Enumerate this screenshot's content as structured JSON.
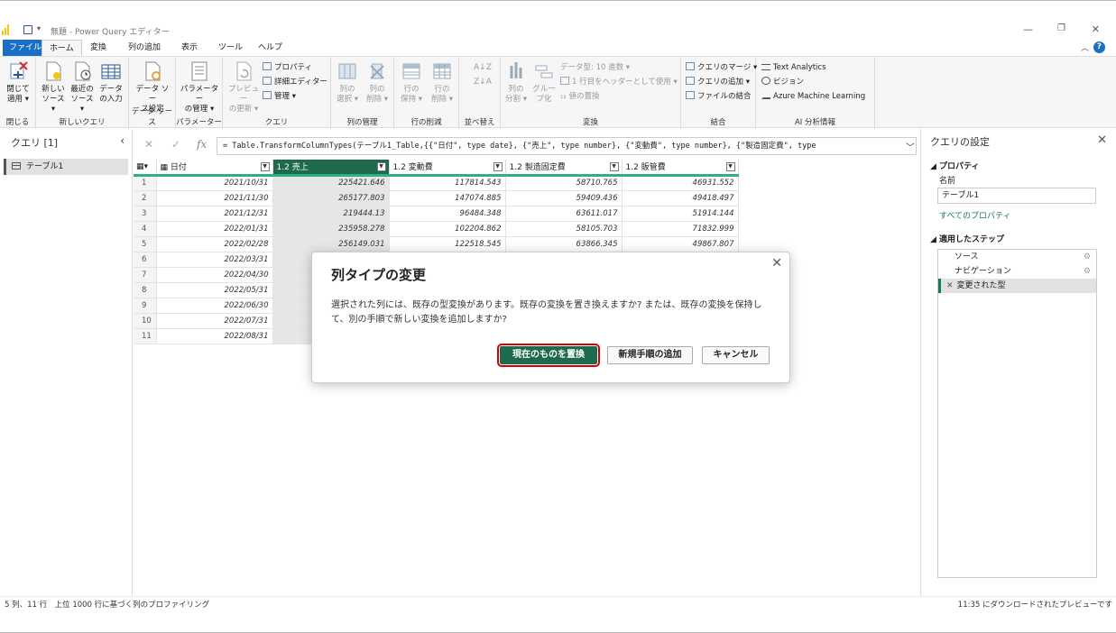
{
  "window": {
    "title": "無題 - Power Query エディター",
    "controls": {
      "minimize": "—",
      "restore": "❐",
      "close": "✕"
    }
  },
  "menu": {
    "tabs": [
      {
        "label": "ファイル"
      },
      {
        "label": "ホーム"
      },
      {
        "label": "変換"
      },
      {
        "label": "列の追加"
      },
      {
        "label": "表示"
      },
      {
        "label": "ツール"
      },
      {
        "label": "ヘルプ"
      }
    ],
    "help": "?"
  },
  "ribbon": {
    "close_apply": "閉じて\n適用 ▾",
    "new_source": "新しい\nソース ▾",
    "recent_sources": "最近の\nソース ▾",
    "enter_data": "データ\nの入力",
    "datasource_settings": "データ ソー\nス設定",
    "manage_params": "パラメーター\nの管理 ▾",
    "refresh_preview": "プレビュー\nの更新 ▾",
    "properties": "プロパティ",
    "advanced_editor": "詳細エディター",
    "manage": "管理 ▾",
    "choose_columns": "列の\n選択 ▾",
    "remove_columns": "列の\n削除 ▾",
    "keep_rows": "行の\n保持 ▾",
    "remove_rows": "行の\n削除 ▾",
    "split_column": "列の\n分割 ▾",
    "group_by": "グルー\nプ化",
    "data_type": "データ型: 10 進数 ▾",
    "use_first_row": "1 行目をヘッダーとして使用 ▾",
    "replace_values": "₁₂ 値の置換",
    "merge_queries": "クエリのマージ ▾",
    "append_queries": "クエリの追加 ▾",
    "combine_files": "ファイルの結合",
    "text_analytics": "Text Analytics",
    "vision": "ビジョン",
    "azure_ml": "Azure Machine Learning",
    "groups": [
      "閉じる",
      "新しいクエリ",
      "データ ソース",
      "パラメーター",
      "クエリ",
      "列の管理",
      "行の削減",
      "並べ替え",
      "変換",
      "結合",
      "AI 分析情報"
    ]
  },
  "queries_pane": {
    "header": "クエリ [1]",
    "items": [
      {
        "label": "テーブル1"
      }
    ]
  },
  "formula_bar": {
    "fx": "fx",
    "cancel": "✕",
    "commit": "✓",
    "formula_prefix": "= Table.TransformColumnTypes(テーブル1_Table,{{",
    "formula_rest": "\"日付\", type date}, {\"売上\", type number}, {\"変動費\", type number}, {\"製造固定費\", type"
  },
  "grid": {
    "columns": [
      {
        "type": "▦",
        "label": "日付"
      },
      {
        "type": "1.2",
        "label": "売上"
      },
      {
        "type": "1.2",
        "label": "変動費"
      },
      {
        "type": "1.2",
        "label": "製造固定費"
      },
      {
        "type": "1.2",
        "label": "販管費"
      }
    ],
    "rows": [
      [
        "1",
        "2021/10/31",
        "225421.646",
        "117814.543",
        "58710.765",
        "46931.552"
      ],
      [
        "2",
        "2021/11/30",
        "265177.803",
        "147074.885",
        "59409.436",
        "49418.497"
      ],
      [
        "3",
        "2021/12/31",
        "219444.13",
        "96484.348",
        "63611.017",
        "51914.144"
      ],
      [
        "4",
        "2022/01/31",
        "235958.278",
        "102204.862",
        "58105.703",
        "71832.999"
      ],
      [
        "5",
        "2022/02/28",
        "256149.031",
        "122518.545",
        "63866.345",
        "49867.807"
      ],
      [
        "6",
        "2022/03/31",
        "",
        "",
        "",
        ""
      ],
      [
        "7",
        "2022/04/30",
        "",
        "",
        "",
        ""
      ],
      [
        "8",
        "2022/05/31",
        "",
        "",
        "",
        ""
      ],
      [
        "9",
        "2022/06/30",
        "",
        "",
        "",
        ""
      ],
      [
        "10",
        "2022/07/31",
        "",
        "",
        "",
        ""
      ],
      [
        "11",
        "2022/08/31",
        "",
        "",
        "",
        ""
      ]
    ]
  },
  "settings_pane": {
    "header": "クエリの設定",
    "properties_section": "◢ プロパティ",
    "name_label": "名前",
    "name_value": "テーブル1",
    "all_properties": "すべてのプロパティ",
    "steps_section": "◢ 適用したステップ",
    "steps": [
      {
        "label": "ソース"
      },
      {
        "label": "ナビゲーション"
      },
      {
        "label": "変更された型"
      }
    ]
  },
  "status_bar": {
    "left": "5 列、11 行　上位 1000 行に基づく列のプロファイリング",
    "right": "11:35 にダウンロードされたプレビューです"
  },
  "dialog": {
    "title": "列タイプの変更",
    "message": "選択された列には、既存の型変換があります。既存の変換を置き換えますか? または、既存の変換を保持して、別の手順で新しい変換を追加しますか?",
    "replace_button": "現在のものを置換",
    "add_step_button": "新規手順の追加",
    "cancel_button": "キャンセル"
  },
  "colors": {
    "accent": "#1f6a4d",
    "file_tab": "#1a6fc4",
    "highlight_outline": "#d40000",
    "column_quality_bar": "#2db08a"
  }
}
